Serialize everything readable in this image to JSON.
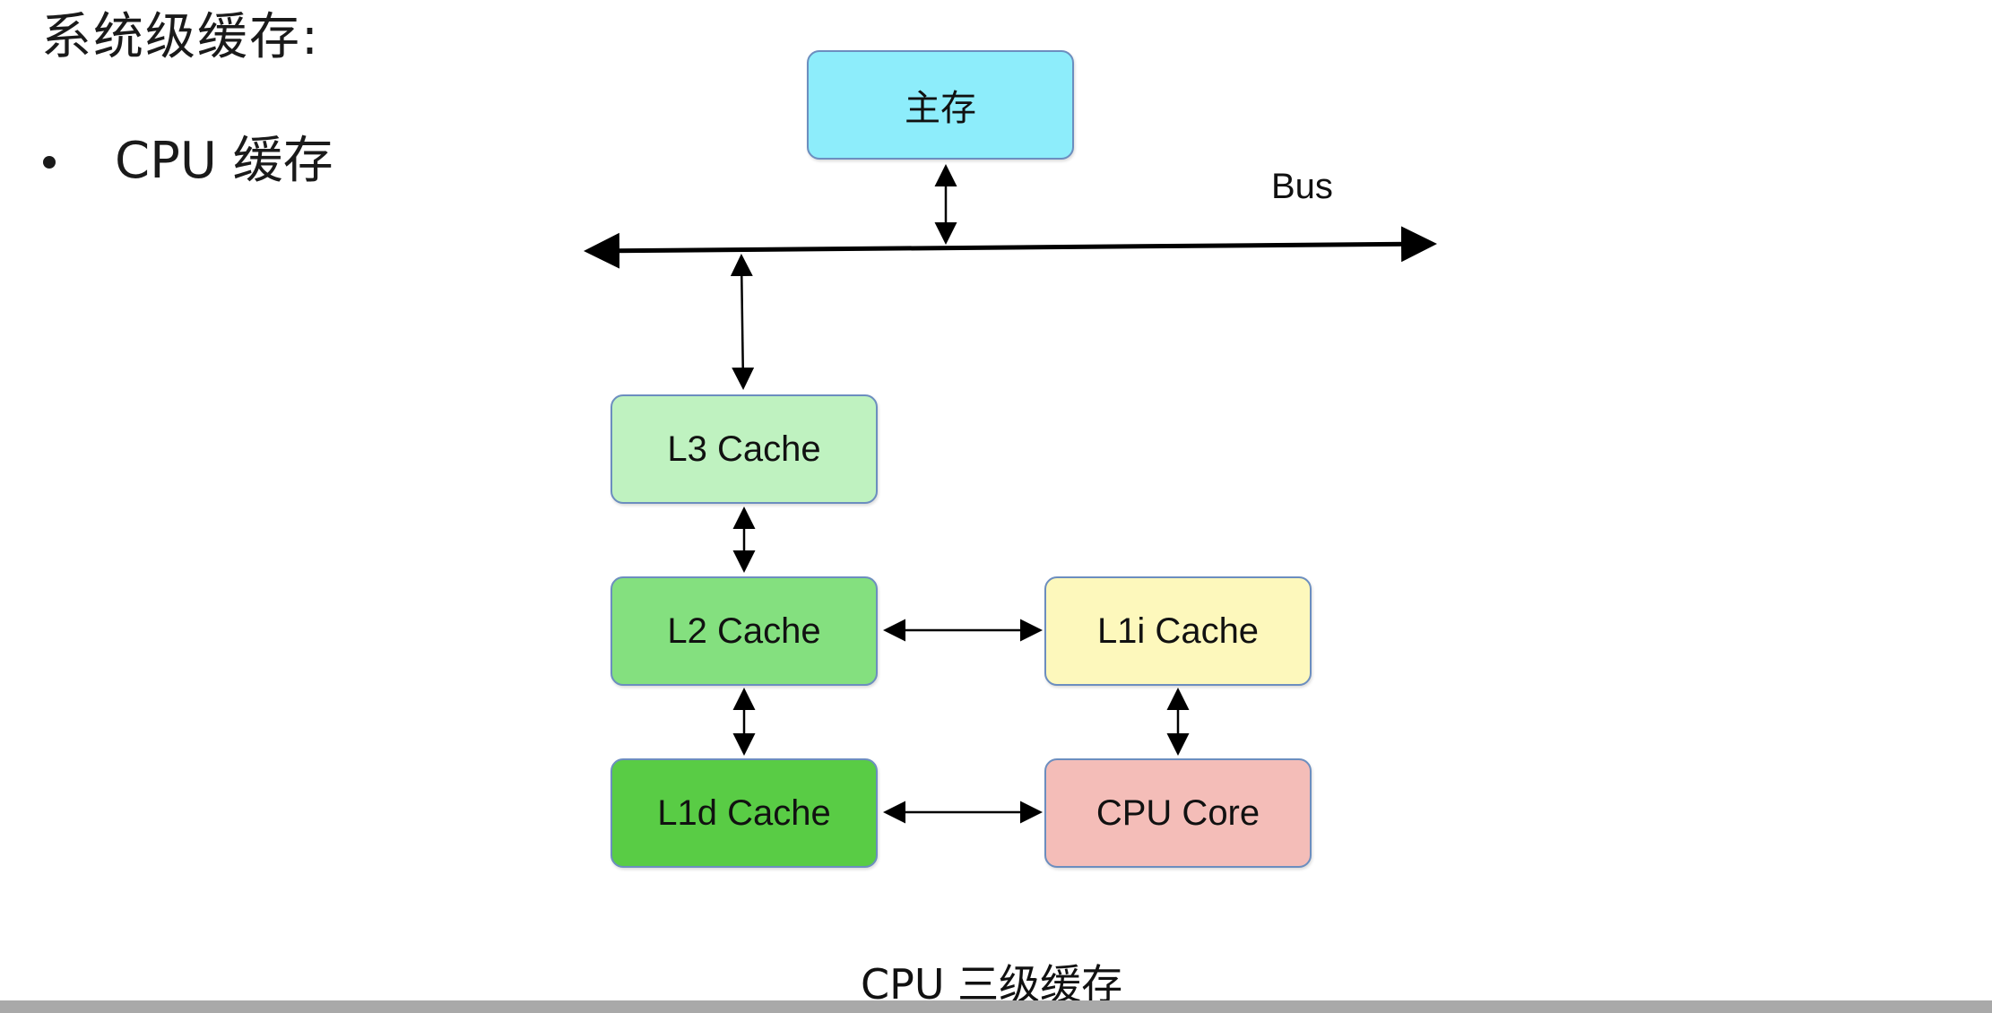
{
  "heading": "系统级缓存:",
  "bullet": "CPU 缓存",
  "diagram": {
    "bus_label": "Bus",
    "nodes": {
      "main_memory": {
        "label": "主存",
        "color": "#8dedfb"
      },
      "l3": {
        "label": "L3 Cache",
        "color": "#bff2c0"
      },
      "l2": {
        "label": "L2 Cache",
        "color": "#84e07f"
      },
      "l1d": {
        "label": "L1d Cache",
        "color": "#59cc45"
      },
      "l1i": {
        "label": "L1i Cache",
        "color": "#fdf8bc"
      },
      "cpu_core": {
        "label": "CPU Core",
        "color": "#f4bdb8"
      }
    },
    "border_color": "#6c8ebf"
  },
  "caption": "CPU 三级缓存"
}
